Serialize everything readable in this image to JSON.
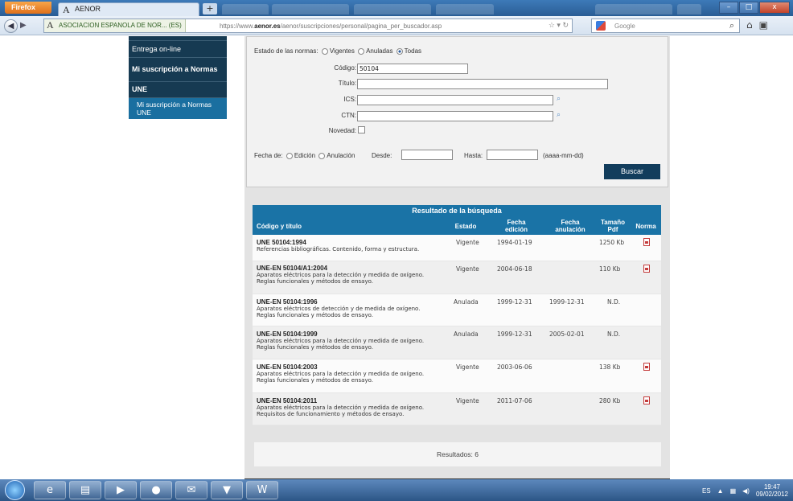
{
  "browser": {
    "menu_button": "Firefox",
    "active_tab": "AENOR",
    "new_tab": "+",
    "site_identity": "ASOCIACION ESPANOLA DE NOR... (ES)",
    "url_prefix": "https://www.",
    "url_domain": "aenor.es",
    "url_path": "/aenor/suscripciones/personal/pagina_per_buscador.asp",
    "search_placeholder": "Google",
    "window_min": "–",
    "window_max": "□",
    "window_close": "x"
  },
  "sidebar": {
    "items": [
      {
        "label": "Entrega on-line"
      },
      {
        "label": "Mi suscripción a Normas"
      },
      {
        "label": "UNE"
      },
      {
        "label": "Mi suscripción a Normas UNE"
      }
    ]
  },
  "form": {
    "estado_label": "Estado de las normas:",
    "estado_options": [
      "Vigentes",
      "Anuladas",
      "Todas"
    ],
    "estado_selected": "Todas",
    "codigo_label": "Código:",
    "codigo_value": "50104",
    "titulo_label": "Título:",
    "titulo_value": "",
    "ics_label": "ICS:",
    "ics_value": "",
    "ctn_label": "CTN:",
    "ctn_value": "",
    "novedad_label": "Novedad:",
    "fecha_label": "Fecha de:",
    "fecha_options": [
      "Edición",
      "Anulación"
    ],
    "desde_label": "Desde:",
    "hasta_label": "Hasta:",
    "date_format": "(aaaa-mm-dd)",
    "submit_label": "Buscar"
  },
  "results": {
    "title": "Resultado de la búsqueda",
    "columns": {
      "codigo": "Código y título",
      "estado": "Estado",
      "fecha_edicion_1": "Fecha",
      "fecha_edicion_2": "edición",
      "fecha_anulacion_1": "Fecha",
      "fecha_anulacion_2": "anulación",
      "tamano_1": "Tamaño",
      "tamano_2": "Pdf",
      "norma": "Norma"
    },
    "rows": [
      {
        "code": "UNE 50104:1994",
        "desc1": "Referencias bibliográficas. Contenido, forma y estructura.",
        "desc2": "",
        "estado": "Vigente",
        "edicion": "1994-01-19",
        "anulacion": "",
        "size": "1250 Kb",
        "pdf": true
      },
      {
        "code": "UNE-EN 50104/A1:2004",
        "desc1": "Aparatos eléctricos para la detección y medida de oxígeno.",
        "desc2": "Reglas funcionales y métodos de ensayo.",
        "estado": "Vigente",
        "edicion": "2004-06-18",
        "anulacion": "",
        "size": "110 Kb",
        "pdf": true
      },
      {
        "code": "UNE-EN 50104:1996",
        "desc1": "Aparatos eléctricos de detección y de medida de oxígeno.",
        "desc2": "Reglas funcionales y métodos de ensayo.",
        "estado": "Anulada",
        "edicion": "1999-12-31",
        "anulacion": "1999-12-31",
        "size": "N.D.",
        "pdf": false
      },
      {
        "code": "UNE-EN 50104:1999",
        "desc1": "Aparatos eléctricos para la detección y medida de oxígeno.",
        "desc2": "Reglas funcionales y métodos de ensayo.",
        "estado": "Anulada",
        "edicion": "1999-12-31",
        "anulacion": "2005-02-01",
        "size": "N.D.",
        "pdf": false
      },
      {
        "code": "UNE-EN 50104:2003",
        "desc1": "Aparatos eléctricos para la detección y medida de oxígeno.",
        "desc2": "Reglas funcionales y métodos de ensayo.",
        "estado": "Vigente",
        "edicion": "2003-06-06",
        "anulacion": "",
        "size": "138 Kb",
        "pdf": true
      },
      {
        "code": "UNE-EN 50104:2011",
        "desc1": "Aparatos eléctricos para la detección y medida de oxígeno.",
        "desc2": "Requisitos de funcionamiento y métodos de ensayo.",
        "estado": "Vigente",
        "edicion": "2011-07-06",
        "anulacion": "",
        "size": "280 Kb",
        "pdf": true
      }
    ],
    "count_label": "Resultados: 6"
  },
  "taskbar": {
    "language": "ES",
    "time": "19:47",
    "date": "09/02/2012"
  },
  "colors": {
    "nav_dark": "#163a52",
    "table_header": "#1a73a6",
    "button": "#123d5c"
  }
}
